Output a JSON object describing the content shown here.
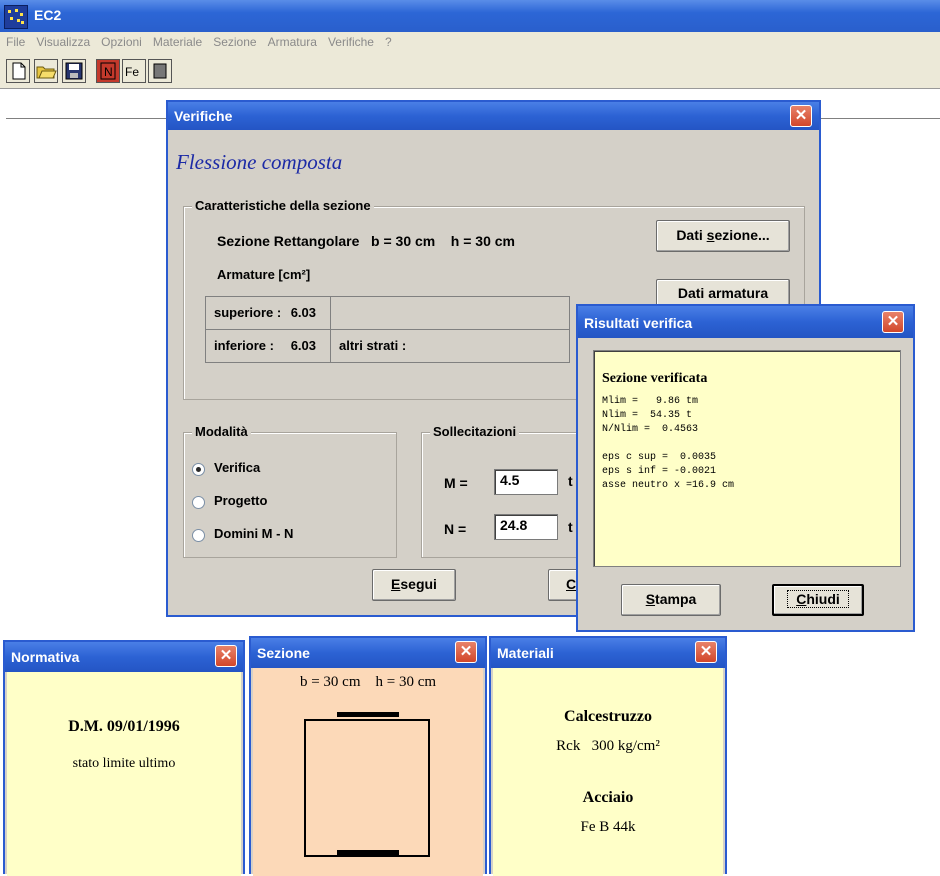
{
  "app": {
    "title": "EC2",
    "menu": [
      "File",
      "Visualizza",
      "Opzioni",
      "Materiale",
      "Sezione",
      "Armatura",
      "Verifiche",
      "?"
    ],
    "toolbar": [
      "new-file-icon",
      "open-folder-icon",
      "save-disk-icon",
      "n-button-icon",
      "fe-button-icon",
      "gray-square-icon"
    ],
    "toolbar_labels": {
      "n": "N",
      "fe": "Fe"
    }
  },
  "verifiche": {
    "title": "Verifiche",
    "heading": "Flessione composta",
    "section_group": "Caratteristiche della sezione",
    "section_text": "Sezione Rettangolare   b = 30 cm    h = 30 cm",
    "dati_sezione": "Dati sezione...",
    "armature_label": "Armature  [cm²]",
    "dati_armatura": "Dati armatura",
    "superiore_label": "superiore :",
    "superiore_value": "6.03",
    "inferiore_label": "inferiore :",
    "inferiore_value": "6.03",
    "altri_strati": "altri strati :",
    "modalita_group": "Modalità",
    "modes": [
      "Verifica",
      "Progetto",
      "Domini M - N"
    ],
    "selected_mode": "Verifica",
    "sollecitazioni_group": "Sollecitazioni",
    "m_label": "M =",
    "m_value": "4.5",
    "m_unit": "t",
    "n_label": "N =",
    "n_value": "24.8",
    "n_unit": "t",
    "esegui": "Esegui",
    "c_button": "C"
  },
  "risultati": {
    "title": "Risultati verifica",
    "heading": "Sezione verificata",
    "lines": [
      "Mlim =   9.86 tm",
      "Nlim =  54.35 t",
      "N/Nlim =  0.4563",
      "",
      "eps c sup =  0.0035",
      "eps s inf = -0.0021",
      "asse neutro x =16.9 cm"
    ],
    "stampa": "Stampa",
    "chiudi": "Chiudi"
  },
  "normativa": {
    "title": "Normativa",
    "line1": "D.M. 09/01/1996",
    "line2": "stato limite ultimo"
  },
  "sezione": {
    "title": "Sezione",
    "dims": "b = 30 cm    h = 30 cm"
  },
  "materiali": {
    "title": "Materiali",
    "cls_title": "Calcestruzzo",
    "cls_value": "Rck   300 kg/cm²",
    "acc_title": "Acciaio",
    "acc_value": "Fe B 44k"
  },
  "colors": {
    "titlebar": "#2c62d4",
    "dialog_bg": "#d4d0c8",
    "yellow_panel": "#ffffc8",
    "peach_panel": "#fcd9b8",
    "close_red": "#d2462a"
  }
}
